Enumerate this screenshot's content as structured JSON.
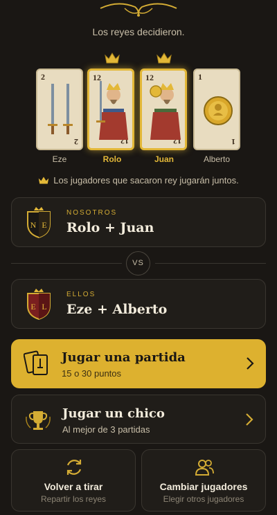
{
  "header": {
    "subtitle": "Los reyes decidieron.",
    "ornament_icon": "gold-flourish-ornament"
  },
  "cards": [
    {
      "player": "Eze",
      "number": "2",
      "suit": "espadas",
      "is_king": false,
      "icon": "swords-icon"
    },
    {
      "player": "Rolo",
      "number": "12",
      "suit": "espadas",
      "is_king": true,
      "icon": "king-swords-icon"
    },
    {
      "player": "Juan",
      "number": "12",
      "suit": "oros",
      "is_king": true,
      "icon": "king-coins-icon"
    },
    {
      "player": "Alberto",
      "number": "1",
      "suit": "oros",
      "is_king": false,
      "icon": "coin-icon"
    }
  ],
  "info_text": "Los jugadores que sacaron rey jugarán juntos.",
  "teams": {
    "us": {
      "label": "NOSOTROS",
      "names": "Rolo + Juan",
      "shield_letters": [
        "N",
        "E"
      ]
    },
    "vs": "VS",
    "them": {
      "label": "ELLOS",
      "names": "Eze + Alberto",
      "shield_letters": [
        "E",
        "L"
      ]
    }
  },
  "actions": {
    "play_match": {
      "title": "Jugar una partida",
      "desc": "15 o 30 puntos",
      "icon": "cards-icon"
    },
    "play_series": {
      "title": "Jugar un chico",
      "desc": "Al mejor de 3 partidas",
      "icon": "trophy-icon"
    },
    "redraw": {
      "title": "Volver a tirar",
      "desc": "Repartir los reyes",
      "icon": "refresh-icon"
    },
    "change_players": {
      "title": "Cambiar jugadores",
      "desc": "Elegir otros jugadores",
      "icon": "users-icon"
    }
  },
  "colors": {
    "background": "#1a1714",
    "gold": "#ddb12f",
    "panel": "#201d19",
    "border": "#3a3630"
  }
}
